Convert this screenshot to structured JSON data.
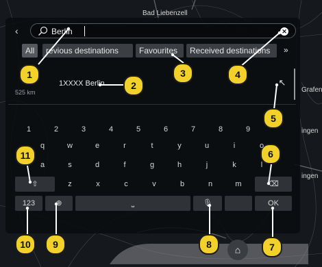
{
  "map": {
    "place_top": "Bad Liebenzell",
    "place_right_1": "Grafen",
    "place_right_2": "ingen",
    "place_right_3": "ingen"
  },
  "search": {
    "back_icon": "chevron-left-icon",
    "query": "Berlin",
    "icon": "search-icon",
    "clear_icon": "close-icon"
  },
  "tabs": {
    "all": "All",
    "previous": "revious destinations",
    "favourites": "Favourites",
    "received": "Received destinations",
    "more": "»"
  },
  "result": {
    "name": "1XXXX Berlin",
    "distance": "525 km",
    "open_icon": "arrow-up-left-icon"
  },
  "keyboard": {
    "row1": [
      "1",
      "2",
      "3",
      "4",
      "5",
      "6",
      "7",
      "8",
      "9"
    ],
    "row2": [
      "q",
      "w",
      "e",
      "r",
      "t",
      "y",
      "u",
      "i",
      "o"
    ],
    "row3": [
      "a",
      "s",
      "d",
      "f",
      "g",
      "h",
      "j",
      "k",
      "l"
    ],
    "row4": [
      "z",
      "x",
      "c",
      "v",
      "b",
      "n",
      "m"
    ],
    "shift_label": "⇧",
    "backspace_label": "⌫",
    "numbers_label": "123",
    "language_label": "⊕",
    "space_label": "⎵",
    "mic_label": "🎙",
    "ok_label": "OK"
  },
  "callouts": [
    "1",
    "2",
    "3",
    "4",
    "5",
    "6",
    "7",
    "8",
    "9",
    "10",
    "11"
  ],
  "home": {
    "icon": "home-icon",
    "label": "⌂"
  },
  "colors": {
    "callout": "#f3d12b",
    "panel": "#0a0c10",
    "key_fn": "#2f3338"
  }
}
